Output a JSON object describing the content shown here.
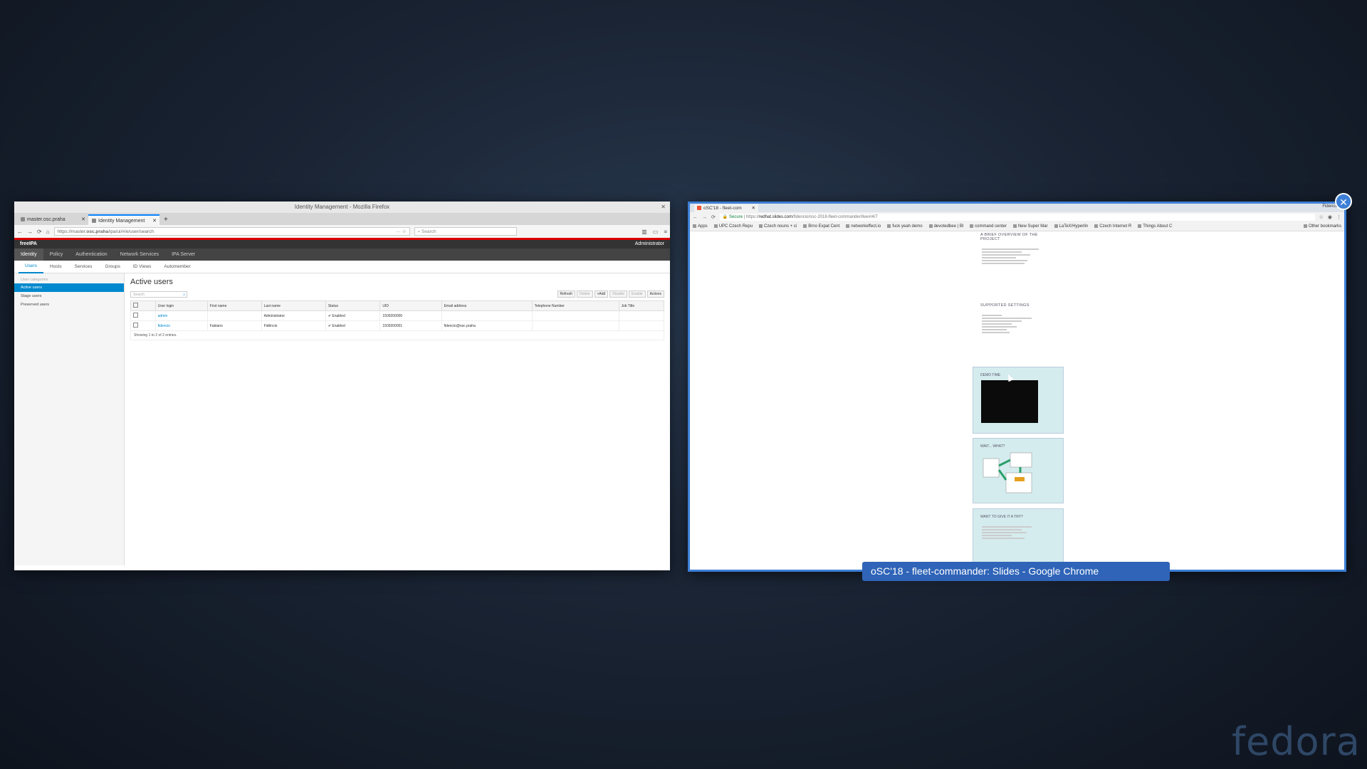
{
  "firefox": {
    "title": "Identity Management - Mozilla Firefox",
    "tabs": [
      {
        "label": "master.osc.praha"
      },
      {
        "label": "Identity Management"
      }
    ],
    "url_prefix": "https://master.",
    "url_domain": "osc.praha",
    "url_path": "/ipa/ui/#/e/user/search",
    "search_placeholder": "Search",
    "freeipa": {
      "logo": "freeIPA",
      "user": "Administrator",
      "menu": [
        "Identity",
        "Policy",
        "Authentication",
        "Network Services",
        "IPA Server"
      ],
      "submenu": [
        "Users",
        "Hosts",
        "Services",
        "Groups",
        "ID Views",
        "Automember"
      ],
      "side_category": "User categories",
      "side_items": [
        "Active users",
        "Stage users",
        "Preserved users"
      ],
      "heading": "Active users",
      "search_placeholder": "Search",
      "buttons": [
        "Refresh",
        "Delete",
        "+Add",
        "Disable",
        "Enable",
        "Actions"
      ],
      "columns": [
        "User login",
        "First name",
        "Last name",
        "Status",
        "UID",
        "Email address",
        "Telephone Number",
        "Job Title"
      ],
      "rows": [
        {
          "login": "admin",
          "first": "",
          "last": "Administrator",
          "status": "✔ Enabled",
          "uid": "1509200000",
          "email": "",
          "phone": "",
          "job": ""
        },
        {
          "login": "fidencio",
          "first": "Fabiano",
          "last": "Fidêncio",
          "status": "✔ Enabled",
          "uid": "1509200001",
          "email": "fidencio@osc.praha",
          "phone": "",
          "job": ""
        }
      ],
      "paging": "Showing 1 to 2 of 2 entries."
    }
  },
  "chrome": {
    "tab_label": "oSC'18 - fleet-com",
    "user": "Fidencio",
    "url_secure": "Secure",
    "url_prefix": "https://",
    "url_domain": "redhat.slides.com",
    "url_path": "/fidencio/osc-2018-fleet-commander/live#/4/7",
    "bookmarks": [
      "Apps",
      "UPC Czech Repu",
      "Czech nouns + ci",
      "Brno Expat Cent",
      "networkeffect.io",
      "fuck yeah demo",
      "devotedbee | Bl",
      "command center",
      "New Super Mar",
      "LaTeX/Hyperlin",
      "Czech Internet R",
      "Things About C"
    ],
    "other_bookmarks": "Other bookmarks",
    "slides": {
      "overview_heading": "A BRIEF OVERVIEW OF THE PROJECT",
      "settings_heading": "SUPPORTED SETTINGS",
      "demo_heading": "DEMO TIME",
      "wait_heading": "WAIT... WHAT?",
      "try_heading": "WANT TO GIVE IT A TRY?"
    }
  },
  "caption": "oSC'18 - fleet-commander: Slides - Google Chrome",
  "brand": "fedora",
  "colors": {
    "accent": "#3d7fd6",
    "caption_bg": "#2f64b8",
    "freeipa_blue": "#0088ce"
  }
}
